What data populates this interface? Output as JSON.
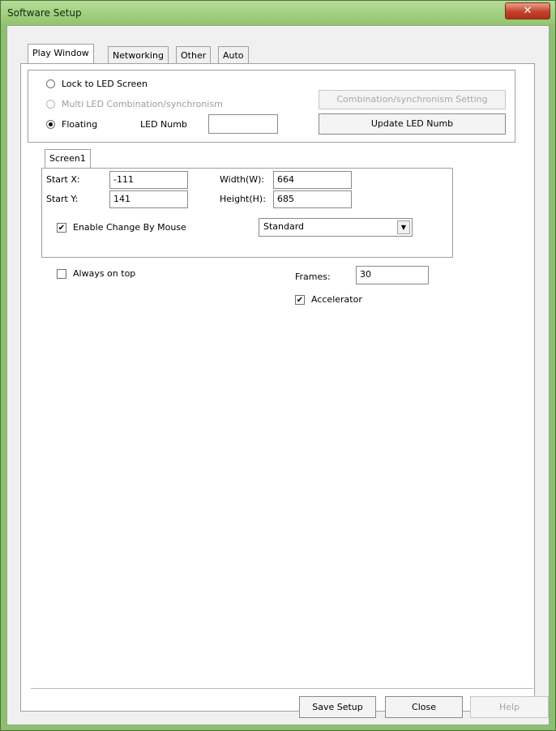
{
  "window": {
    "title": "Software Setup",
    "close_glyph": "✕"
  },
  "tabs": [
    "Play Window",
    "Networking",
    "Other",
    "Auto"
  ],
  "active_tab": "Play Window",
  "mode_group": {
    "options": [
      {
        "label": "Lock to LED Screen",
        "checked": false,
        "enabled": true
      },
      {
        "label": "Multi LED Combination/synchronism",
        "checked": false,
        "enabled": false
      },
      {
        "label": "Floating",
        "checked": true,
        "enabled": true
      }
    ],
    "led_numb_label": "LED Numb",
    "led_numb_value": "",
    "combination_button": "Combination/synchronism Setting",
    "update_button": "Update LED Numb"
  },
  "screen_tabs": [
    "Screen1"
  ],
  "screen": {
    "start_x_label": "Start X:",
    "start_x": "-111",
    "start_y_label": "Start Y:",
    "start_y": "141",
    "width_label": "Width(W):",
    "width": "664",
    "height_label": "Height(H):",
    "height": "685",
    "enable_change_label": "Enable Change By Mouse",
    "enable_change_checked": true,
    "mode_select": "Standard"
  },
  "always_on_top": {
    "label": "Always on top",
    "checked": false
  },
  "frames": {
    "label": "Frames:",
    "value": "30"
  },
  "accelerator": {
    "label": "Accelerator",
    "checked": true
  },
  "buttons": {
    "save": "Save Setup",
    "close": "Close",
    "help": "Help"
  },
  "colors": {
    "frame": "#8cc06e",
    "close_button": "#c6412b",
    "client": "#f0f0f0"
  }
}
